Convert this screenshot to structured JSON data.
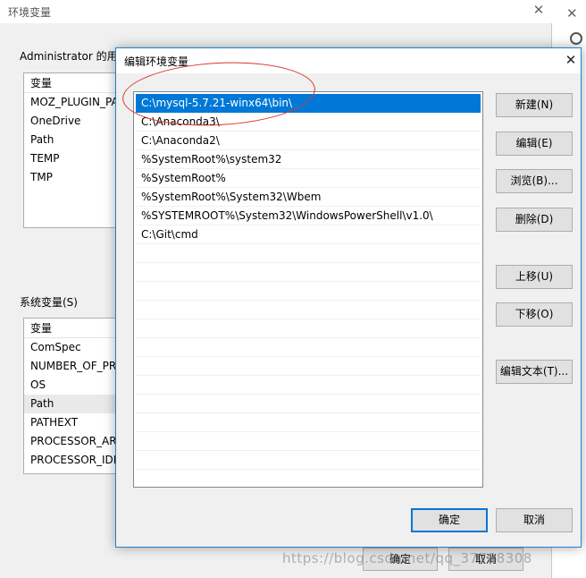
{
  "background_window": {
    "title": "环境变量",
    "close_glyph": "✕",
    "user_section_label": "Administrator 的用",
    "system_section_label": "系统变量(S)",
    "user_vars": {
      "header": "变量",
      "rows": [
        "MOZ_PLUGIN_PA",
        "OneDrive",
        "Path",
        "TEMP",
        "TMP"
      ]
    },
    "system_vars": {
      "header": "变量",
      "rows": [
        "ComSpec",
        "NUMBER_OF_PR",
        "OS",
        "Path",
        "PATHEXT",
        "PROCESSOR_ARC",
        "PROCESSOR_IDE"
      ]
    },
    "ok_label": "确定",
    "cancel_label": "取消"
  },
  "dialog": {
    "title": "编辑环境变量",
    "close_glyph": "✕",
    "paths": [
      "C:\\mysql-5.7.21-winx64\\bin\\",
      "C:\\Anaconda3\\",
      "C:\\Anaconda2\\",
      "%SystemRoot%\\system32",
      "%SystemRoot%",
      "%SystemRoot%\\System32\\Wbem",
      "%SYSTEMROOT%\\System32\\WindowsPowerShell\\v1.0\\",
      "C:\\Git\\cmd"
    ],
    "buttons": {
      "new": "新建(N)",
      "edit": "编辑(E)",
      "browse": "浏览(B)...",
      "delete": "删除(D)",
      "move_up": "上移(U)",
      "move_down": "下移(O)",
      "edit_text": "编辑文本(T)...",
      "ok": "确定",
      "cancel": "取消"
    }
  },
  "side_window": {
    "close_glyph": "✕"
  },
  "watermark": "https://blog.csdn.net/qq_37788308",
  "colors": {
    "selection": "#0078d7",
    "annotation": "#e0352b"
  }
}
